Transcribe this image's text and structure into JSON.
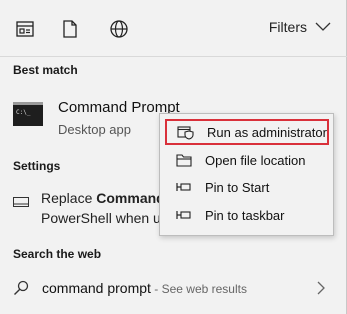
{
  "topbar": {
    "icons": [
      "apps-icon",
      "document-icon",
      "globe-icon"
    ],
    "filters_label": "Filters"
  },
  "best_match": {
    "heading": "Best match",
    "title": "Command Prompt",
    "subtitle": "Desktop app"
  },
  "settings": {
    "heading": "Settings",
    "line1_pre": "Replace ",
    "line1_bold": "Command",
    "line2": "PowerShell when u"
  },
  "web": {
    "heading": "Search the web",
    "query": "command prompt",
    "hint": " - See web results"
  },
  "context_menu": {
    "items": [
      {
        "label": "Run as administrator",
        "icon": "shield-icon",
        "highlighted": true
      },
      {
        "label": "Open file location",
        "icon": "folder-icon",
        "highlighted": false
      },
      {
        "label": "Pin to Start",
        "icon": "pin-icon",
        "highlighted": false
      },
      {
        "label": "Pin to taskbar",
        "icon": "pin-icon",
        "highlighted": false
      }
    ]
  },
  "colors": {
    "highlight_border": "#d9303a",
    "background": "#f2f2f2"
  }
}
